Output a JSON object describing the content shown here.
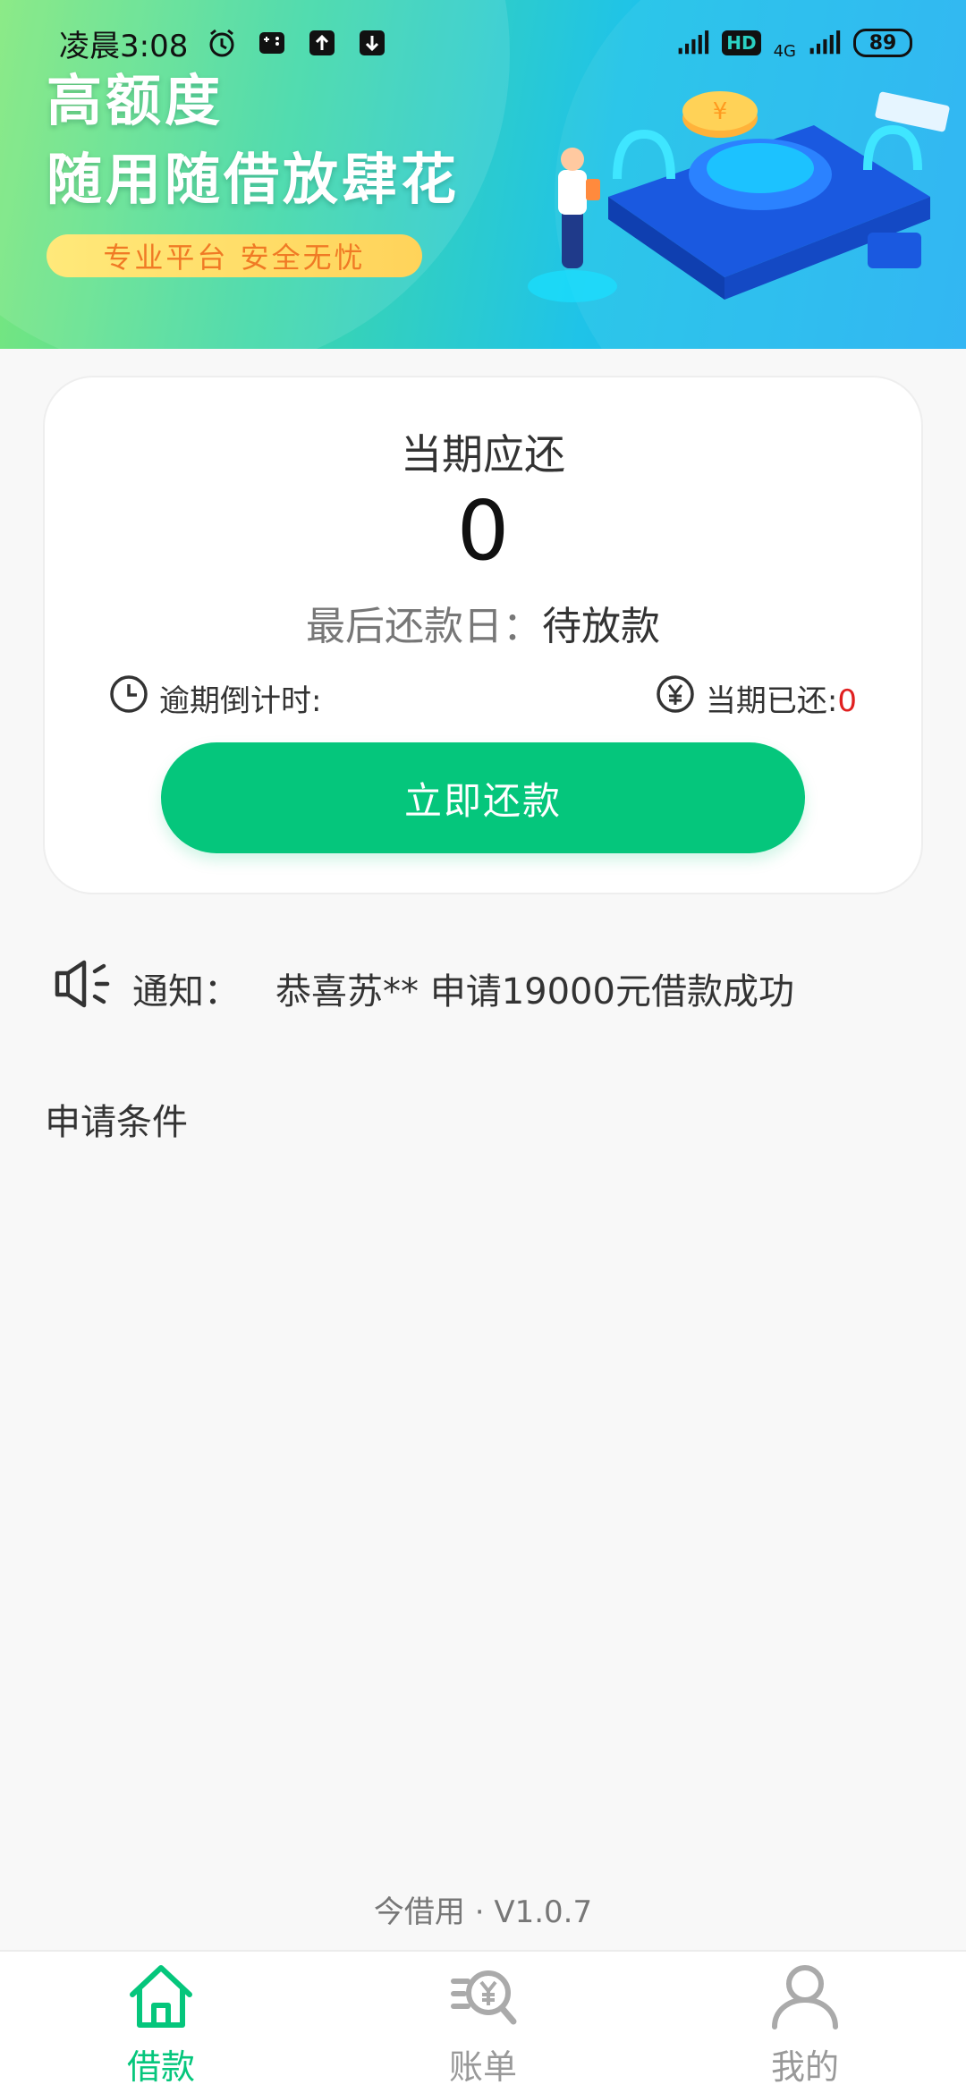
{
  "status_bar": {
    "time": "凌晨3:08",
    "network": "4G",
    "hd": "HD",
    "battery": "89"
  },
  "banner": {
    "title": "高额度",
    "subtitle": "随用随借放肆花",
    "tag": "专业平台 安全无忧"
  },
  "repayment": {
    "title": "当期应还",
    "amount": "0",
    "due_label": "最后还款日：",
    "due_value": "待放款",
    "countdown_label": "逾期倒计时:",
    "countdown_value": "",
    "paid_label": "当期已还:",
    "paid_value": "0",
    "button_label": "立即还款"
  },
  "notice": {
    "label": "通知：",
    "text": "恭喜苏** 申请19000元借款成功"
  },
  "section": {
    "title": "申请条件"
  },
  "footer": {
    "version": "今借用 · V1.0.7"
  },
  "tabs": [
    {
      "label": "借款",
      "icon": "home-icon",
      "active": true
    },
    {
      "label": "账单",
      "icon": "bill-icon",
      "active": false
    },
    {
      "label": "我的",
      "icon": "user-icon",
      "active": false
    }
  ],
  "colors": {
    "accent": "#05c67c",
    "paid_value": "#e02020",
    "text": "#333333",
    "muted": "#999999"
  }
}
